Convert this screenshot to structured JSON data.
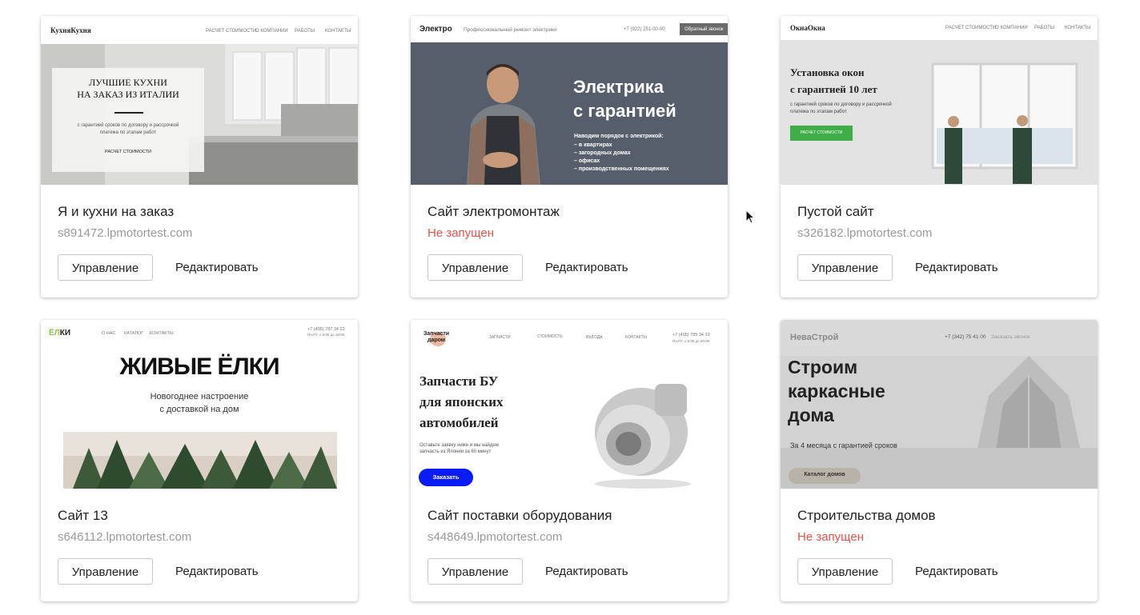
{
  "sites": [
    {
      "name": "Я и кухни на заказ",
      "domain": "s891472.lpmotortest.com",
      "manage_label": "Управление",
      "edit_label": "Редактировать",
      "preview": {
        "logo": "КухняКухня",
        "nav": [
          "РАСЧЕТ СТОИМОСТИ",
          "О КОМПАНИИ",
          "РАБОТЫ",
          "КОНТАКТЫ"
        ],
        "headline_1": "ЛУЧШИЕ КУХНИ",
        "headline_2": "НА ЗАКАЗ ИЗ ИТАЛИИ",
        "sub_1": "с гарантией сроков по договору и рассрочкой",
        "sub_2": "платежа по этапам работ",
        "cta": "РАСЧЕТ СТОИМОСТИ"
      }
    },
    {
      "name": "Сайт электромонтаж",
      "status": "Не запущен",
      "manage_label": "Управление",
      "edit_label": "Редактировать",
      "preview": {
        "logo": "Электро",
        "tagline": "Профессиональный ремонт электрики",
        "phone": "+7 (922) 251-00-00",
        "callback": "Обратный звонок",
        "headline_1": "Электрика",
        "headline_2": "с гарантией",
        "lead": "Наводим порядок с электрикой:",
        "bullets": [
          "– в квартирах",
          "– загородных домах",
          "– офисах",
          "– производственных помещениях"
        ]
      }
    },
    {
      "name": "Пустой сайт",
      "domain": "s326182.lpmotortest.com",
      "manage_label": "Управление",
      "edit_label": "Редактировать",
      "preview": {
        "logo": "ОкнаОкна",
        "nav": [
          "РАСЧЕТ СТОИМОСТИ",
          "О КОМПАНИИ",
          "РАБОТЫ",
          "КОНТАКТЫ"
        ],
        "headline_1": "Установка окон",
        "headline_2": "с гарантией 10 лет",
        "sub_1": "с гарантией сроков по договору и рассрочкой",
        "sub_2": "платежа по этапам работ",
        "cta": "РАСЧЕТ СТОИМОСТИ"
      }
    },
    {
      "name": "Сайт 13",
      "domain": "s646112.lpmotortest.com",
      "manage_label": "Управление",
      "edit_label": "Редактировать",
      "preview": {
        "logo_a": "ЁЛ",
        "logo_b": "КИ",
        "nav": [
          "О НАС",
          "КАТАЛОГ",
          "КОНТАКТЫ"
        ],
        "phone": "+7 (495) 787 34 22",
        "hours": "Пн-Пт: с 8:00 до 18:00",
        "headline": "ЖИВЫЕ ЁЛКИ",
        "sub_1": "Новогоднее настроение",
        "sub_2": "с доставкой на дом"
      }
    },
    {
      "name": "Сайт поставки оборудования",
      "domain": "s448649.lpmotortest.com",
      "manage_label": "Управление",
      "edit_label": "Редактировать",
      "preview": {
        "logo_1": "Запчасти",
        "logo_2": "даром",
        "nav": [
          "ЗАПЧАСТИ",
          "СТОИМОСТЬ",
          "ВЫГОДА",
          "КОНТАКТЫ"
        ],
        "phone": "+7 (495) 785 34 33",
        "hours": "Пн-Пт: с 8:00 до 20:00",
        "headline_1": "Запчасти БУ",
        "headline_2": "для японских",
        "headline_3": "автомобилей",
        "sub_1": "Оставьте заявку ниже и мы найдем",
        "sub_2": "запчасть из Японии за 60 минут",
        "cta": "Заказать"
      }
    },
    {
      "name": "Строительства домов",
      "status": "Не запущен",
      "manage_label": "Управление",
      "edit_label": "Редактировать",
      "preview": {
        "logo": "НеваСтрой",
        "phone": "+7 (342) 75 41 00",
        "callback": "Заказать звонок",
        "headline_1": "Строим",
        "headline_2": "каркасные",
        "headline_3": "дома",
        "sub": "За 4 месяца с гарантией сроков",
        "cta": "Каталог домов"
      }
    }
  ],
  "colors": {
    "status_error": "#e6534d",
    "domain_text": "#9a9a9a",
    "electro_bg": "#565e6c",
    "okna_cta": "#3fae49",
    "zapchasti_cta": "#0a1cf5",
    "elki_green": "#8bc34a"
  }
}
